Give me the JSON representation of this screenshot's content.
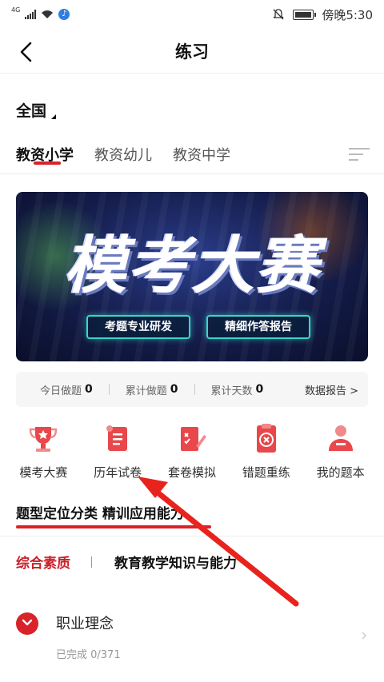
{
  "status_bar": {
    "network": "4G",
    "time": "傍晚5:30"
  },
  "header": {
    "title": "练习"
  },
  "region": {
    "label": "全国"
  },
  "tabs": [
    {
      "label": "教资小学",
      "active": true
    },
    {
      "label": "教资幼儿",
      "active": false
    },
    {
      "label": "教资中学",
      "active": false
    }
  ],
  "banner": {
    "title": "模考大赛",
    "pill_1": "考题专业研发",
    "pill_2": "精细作答报告"
  },
  "stats": {
    "today_label": "今日做题",
    "today_value": "0",
    "total_label": "累计做题",
    "total_value": "0",
    "days_label": "累计天数",
    "days_value": "0",
    "report_link": "数据报告 >"
  },
  "quick_actions": [
    {
      "label": "模考大赛",
      "icon": "trophy-icon"
    },
    {
      "label": "历年试卷",
      "icon": "scroll-icon"
    },
    {
      "label": "套卷模拟",
      "icon": "exam-paper-icon"
    },
    {
      "label": "错题重练",
      "icon": "wrong-answer-icon"
    },
    {
      "label": "我的题本",
      "icon": "user-book-icon"
    }
  ],
  "section": {
    "heading": "题型定位分类 精训应用能力"
  },
  "subjects": {
    "active": "综合素质",
    "other": "教育教学知识与能力"
  },
  "topic": {
    "title": "职业理念",
    "progress": "已完成 0/371"
  },
  "colors": {
    "accent": "#d9222a",
    "banner_bg": "#141c4a",
    "pill_border": "#3bd6c8"
  }
}
